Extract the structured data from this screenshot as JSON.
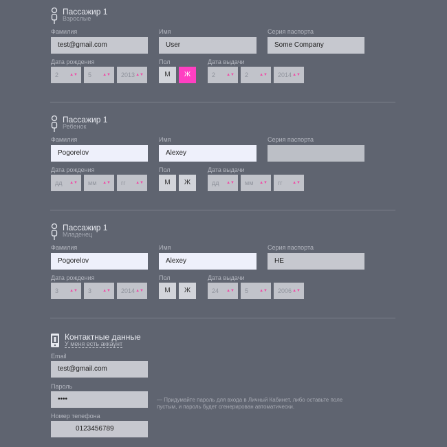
{
  "passengers": [
    {
      "title": "Пассажир 1",
      "type": "Взрослые",
      "surname_label": "Фамилия",
      "surname": "test@gmail.com",
      "name_label": "Имя",
      "name": "User",
      "passport_label": "Серия паспорта",
      "passport": "Some Company",
      "dob_label": "Дата рождения",
      "dob": [
        "2",
        "5",
        "2013"
      ],
      "gender_label": "Пол",
      "gender_m": "М",
      "gender_f": "Ж",
      "issue_label": "Дата выдачи",
      "issue": [
        "2",
        "2",
        "2014"
      ]
    },
    {
      "title": "Пассажир 1",
      "type": "Ребенок",
      "surname_label": "Фамилия",
      "surname": "Pogorelov",
      "name_label": "Имя",
      "name": "Alexey",
      "passport_label": "Серия паспорта",
      "passport": "",
      "dob_label": "Дата рождения",
      "dob": [
        "дд",
        "мм",
        "гг"
      ],
      "gender_label": "Пол",
      "gender_m": "М",
      "gender_f": "Ж",
      "issue_label": "Дата выдачи",
      "issue": [
        "дд",
        "мм",
        "гг"
      ]
    },
    {
      "title": "Пассажир 1",
      "type": "Младенец",
      "surname_label": "Фамилия",
      "surname": "Pogorelov",
      "name_label": "Имя",
      "name": "Alexey",
      "passport_label": "Серия паспорта",
      "passport": "НЕ",
      "dob_label": "Дата рождения",
      "dob": [
        "3",
        "3",
        "2014"
      ],
      "gender_label": "Пол",
      "gender_m": "М",
      "gender_f": "Ж",
      "issue_label": "Дата выдачи",
      "issue": [
        "24",
        "5",
        "2006"
      ]
    }
  ],
  "contacts": {
    "title": "Контактные данные",
    "have_account": "У меня есть аккаунт",
    "email_label": "Email",
    "email": "test@gmail.com",
    "password_label": "Пароль",
    "password": "••••",
    "password_hint": "— Придумайте пароль для входа в Личный Кабинет, либо оставьте поле пустым, и пароль будет сгенерирован автоматически.",
    "phone_label": "Номер телефона",
    "phone": "0123456789"
  },
  "colors": {
    "background": "#5f6470",
    "accent": "#ff3fc2"
  },
  "selected_gender": [
    "Ж",
    null,
    null
  ]
}
